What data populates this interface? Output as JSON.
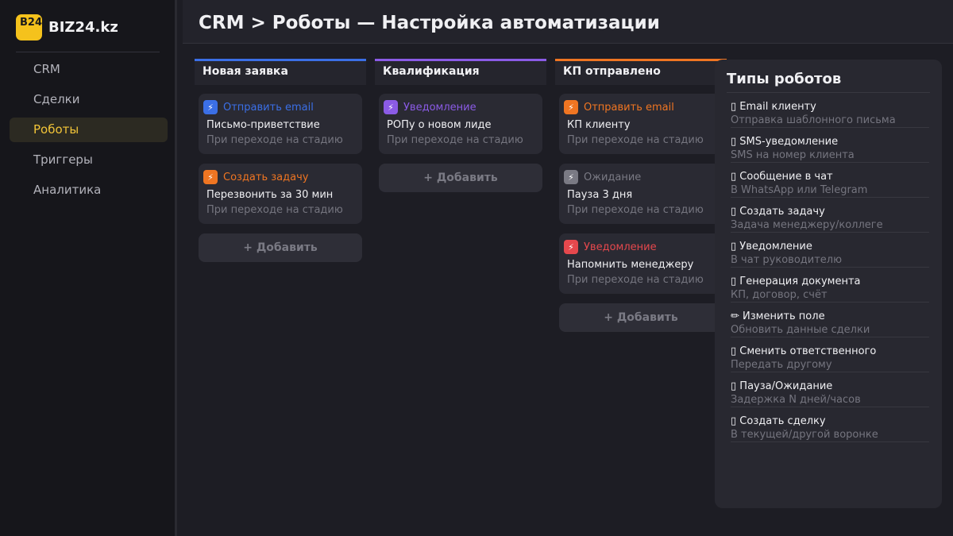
{
  "brand": {
    "logo_text": "B24",
    "name": "BIZ24.kz",
    "accent": "#f5c21c"
  },
  "nav": {
    "items": [
      {
        "label": "CRM",
        "active": false
      },
      {
        "label": "Сделки",
        "active": false
      },
      {
        "label": "Роботы",
        "active": true
      },
      {
        "label": "Триггеры",
        "active": false
      },
      {
        "label": "Аналитика",
        "active": false
      }
    ]
  },
  "header": {
    "title": "CRM > Роботы — Настройка автоматизации"
  },
  "columns": [
    {
      "title": "Новая заявка",
      "color": "#3b6fe6",
      "cards": [
        {
          "type": "Отправить email",
          "name": "Письмо-приветствие",
          "trigger": "При переходе на стадию",
          "color": "#3b6fe6",
          "icon": "lightning-icon"
        },
        {
          "type": "Создать задачу",
          "name": "Перезвонить за 30 мин",
          "trigger": "При переходе на стадию",
          "color": "#ef7522",
          "icon": "lightning-icon"
        }
      ],
      "add_label": "+ Добавить"
    },
    {
      "title": "Квалификация",
      "color": "#8b5be6",
      "cards": [
        {
          "type": "Уведомление",
          "name": "РОПу о новом лиде",
          "trigger": "При переходе на стадию",
          "color": "#8b5be6",
          "icon": "lightning-icon"
        }
      ],
      "add_label": "+ Добавить"
    },
    {
      "title": "КП отправлено",
      "color": "#ef7522",
      "cards": [
        {
          "type": "Отправить email",
          "name": "КП клиенту",
          "trigger": "При переходе на стадию",
          "color": "#ef7522",
          "icon": "lightning-icon"
        },
        {
          "type": "Ожидание",
          "name": "Пауза 3 дня",
          "trigger": "При переходе на стадию",
          "color": "#7a7a84",
          "icon": "lightning-icon"
        },
        {
          "type": "Уведомление",
          "name": "Напомнить менеджеру",
          "trigger": "При переходе на стадию",
          "color": "#e5484d",
          "icon": "lightning-icon"
        }
      ],
      "add_label": "+ Добавить"
    }
  ],
  "robot_types": {
    "title": "Типы роботов",
    "items": [
      {
        "icon": "envelope-icon",
        "glyph": "▯",
        "label": "Email клиенту",
        "desc": "Отправка шаблонного письма"
      },
      {
        "icon": "phone-icon",
        "glyph": "▯",
        "label": "SMS-уведомление",
        "desc": "SMS на номер клиента"
      },
      {
        "icon": "chat-icon",
        "glyph": "▯",
        "label": "Сообщение в чат",
        "desc": "В WhatsApp или Telegram"
      },
      {
        "icon": "task-icon",
        "glyph": "▯",
        "label": "Создать задачу",
        "desc": "Задача менеджеру/коллеге"
      },
      {
        "icon": "bell-icon",
        "glyph": "▯",
        "label": "Уведомление",
        "desc": "В чат руководителю"
      },
      {
        "icon": "document-icon",
        "glyph": "▯",
        "label": "Генерация документа",
        "desc": "КП, договор, счёт"
      },
      {
        "icon": "pencil-icon",
        "glyph": "✏",
        "label": "Изменить поле",
        "desc": "Обновить данные сделки"
      },
      {
        "icon": "user-swap-icon",
        "glyph": "▯",
        "label": "Сменить ответственного",
        "desc": "Передать другому"
      },
      {
        "icon": "pause-icon",
        "glyph": "▯",
        "label": "Пауза/Ожидание",
        "desc": "Задержка N дней/часов"
      },
      {
        "icon": "plus-deal-icon",
        "glyph": "▯",
        "label": "Создать сделку",
        "desc": "В текущей/другой воронке"
      }
    ]
  }
}
